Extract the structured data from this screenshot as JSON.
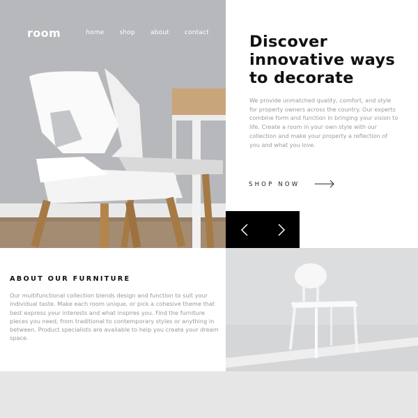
{
  "nav": {
    "logo": "room",
    "links": [
      "home",
      "shop",
      "about",
      "contact"
    ]
  },
  "hero": {
    "title_lines": [
      "Discover",
      "innovative ways",
      "to decorate"
    ],
    "description": "We provide unmatched quality, comfort, and style for property owners across the country. Our experts combine form and function in bringing your vision to life. Create a room in your own style with our collection and make your property a reflection of you and what you love.",
    "cta_label": "SHOP NOW",
    "cta_icon": "arrow-right-icon",
    "slider": {
      "prev_icon": "chevron-left-icon",
      "next_icon": "chevron-right-icon"
    }
  },
  "about": {
    "title": "ABOUT OUR FURNITURE",
    "description": "Our multifunctional collection blends design and function to suit your individual taste. Make each room unique, or pick a cohesive theme that best express your interests and what inspires you. Find the furniture pieces you need, from traditional to contemporary styles or anything in between. Product specialists are available to help you create your dream space."
  },
  "colors": {
    "accent": "#000000",
    "text_dark": "#111111",
    "text_muted": "#9a9a9a",
    "background_light": "#e6e6e6"
  }
}
